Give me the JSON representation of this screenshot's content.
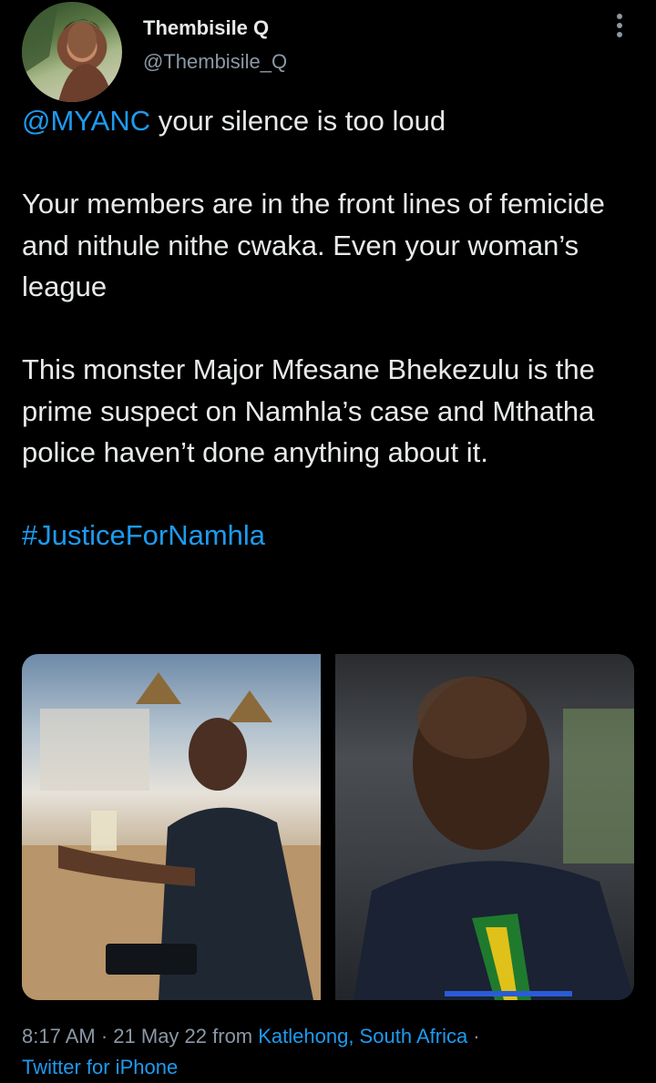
{
  "author": {
    "name": "Thembisile Q",
    "handle": "@Thembisile_Q"
  },
  "tweet": {
    "line1_mention": "@MYANC",
    "line1_rest": " your silence is too loud",
    "paragraph2": "Your members are in the front lines of femicide and nithule nithe cwaka. Even your woman’s league",
    "paragraph3": "This monster Major Mfesane Bhekezulu is the prime suspect on Namhla’s case and Mthatha police haven’t done anything about it.",
    "hashtag": "#JusticeForNamhla"
  },
  "meta": {
    "time": "8:17 AM",
    "separator1": " · ",
    "date": "21 May 22",
    "from_word": " from ",
    "location": "Katlehong, South Africa",
    "separator2": " · ",
    "source": "Twitter for iPhone"
  },
  "icons": {
    "more": "more-vertical-icon"
  },
  "colors": {
    "background": "#000000",
    "text": "#e7e9ea",
    "secondary": "#8b98a5",
    "link": "#1d9bf0"
  }
}
